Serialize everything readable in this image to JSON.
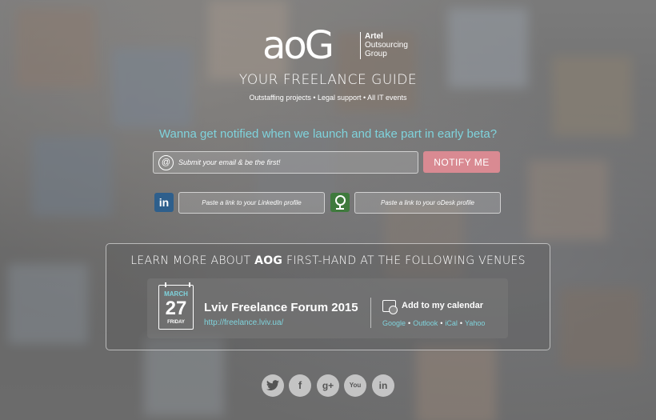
{
  "brand": {
    "logo_mark": "aoG",
    "company_line1": "Artel",
    "company_line2": "Outsourcing",
    "company_line3": "Group",
    "tagline": "YOUR FREELANCE GUIDE",
    "services": "Outstaffing projects • Legal support • All IT events"
  },
  "signup": {
    "headline": "Wanna get notified when we launch and take part in early beta?",
    "email_placeholder": "Submit your email & be the first!",
    "notify_label": "NOTIFY ME",
    "linkedin_badge": "in",
    "linkedin_placeholder": "Paste a link to your LinkedIn profile",
    "odesk_placeholder": "Paste a link to your oDesk profile"
  },
  "venues": {
    "title_prefix": "LEARN MORE ABOUT ",
    "title_brand": "AOG",
    "title_suffix": " FIRST-HAND AT THE FOLLOWING VENUES",
    "event": {
      "month": "MARCH",
      "day": "27",
      "weekday": "FRIDAY",
      "name": "Lviv Freelance Forum 2015",
      "url": "http://freelance.lviv.ua/",
      "add_calendar": "Add to my calendar",
      "calendars": [
        "Google",
        "Outlook",
        "iCal",
        "Yahoo"
      ]
    }
  },
  "social": {
    "twitter": "t",
    "facebook": "f",
    "googleplus": "g+",
    "youtube": "You",
    "linkedin": "in"
  },
  "colors": {
    "accent": "#7fd3dc",
    "notify_button": "#d98a92",
    "linkedin": "#2e5f8c",
    "odesk": "#3f7a3d"
  }
}
